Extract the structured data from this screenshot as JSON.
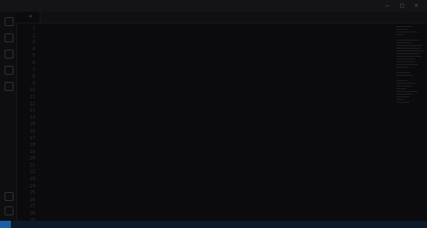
{
  "window": {
    "title": "",
    "controls": [
      "—",
      "□",
      "✕"
    ]
  },
  "tabs": [
    {
      "label": "",
      "close": "×"
    }
  ],
  "editor": {
    "line_numbers": [
      "1",
      "2",
      "3",
      "4",
      "5",
      "6",
      "7",
      "8",
      "9",
      "10",
      "11",
      "12",
      "13",
      "14",
      "15",
      "16",
      "17",
      "18",
      "19",
      "20",
      "21",
      "22",
      "23",
      "24",
      "25",
      "26",
      "27",
      "28",
      "29"
    ],
    "lines": []
  },
  "status": {
    "left": "",
    "right": ""
  },
  "colors": {
    "background": "#0b0b0d",
    "status_bar": "#0d1a2a",
    "remote_badge": "#1a5fa8"
  }
}
